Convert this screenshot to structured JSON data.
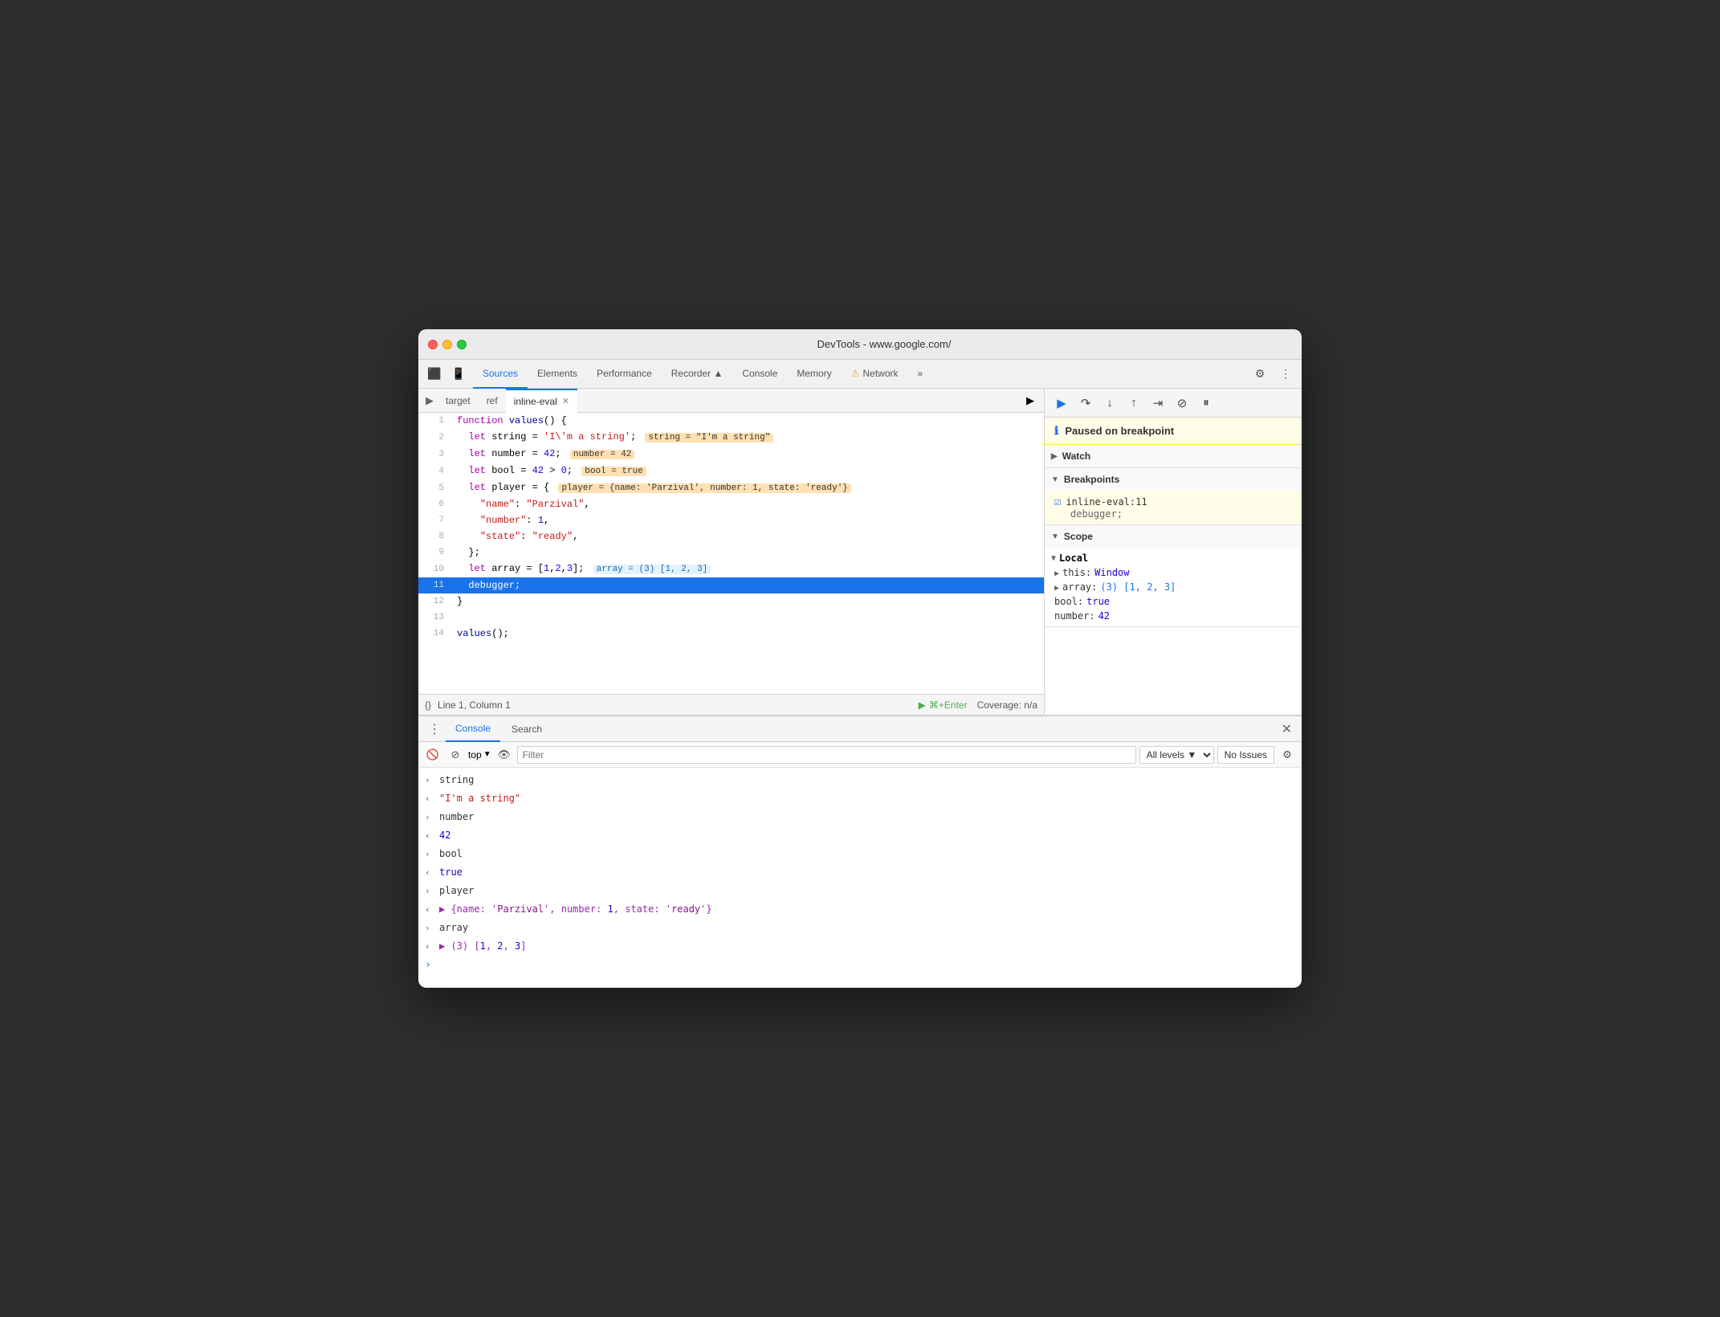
{
  "window": {
    "title": "DevTools - www.google.com/"
  },
  "tabs": {
    "items": [
      {
        "label": "Elements",
        "active": false
      },
      {
        "label": "Sources",
        "active": true
      },
      {
        "label": "Performance",
        "active": false
      },
      {
        "label": "Recorder ▲",
        "active": false
      },
      {
        "label": "Console",
        "active": false
      },
      {
        "label": "Memory",
        "active": false
      },
      {
        "label": "Network",
        "active": false
      }
    ],
    "more": "»"
  },
  "file_tabs": {
    "items": [
      {
        "label": "target",
        "active": false,
        "closable": false
      },
      {
        "label": "ref",
        "active": false,
        "closable": false
      },
      {
        "label": "inline-eval",
        "active": true,
        "closable": true
      }
    ]
  },
  "code": {
    "lines": [
      {
        "num": 1,
        "content": "function values() {"
      },
      {
        "num": 2,
        "content": "  let string = 'I\\'m a string';  string = \"I'm a string\""
      },
      {
        "num": 3,
        "content": "  let number = 42;  number = 42"
      },
      {
        "num": 4,
        "content": "  let bool = 42 > 0;  bool = true"
      },
      {
        "num": 5,
        "content": "  let player = {  player = {name: 'Parzival', number: 1, state: 'ready'}"
      },
      {
        "num": 6,
        "content": "    \"name\": \"Parzival\","
      },
      {
        "num": 7,
        "content": "    \"number\": 1,"
      },
      {
        "num": 8,
        "content": "    \"state\": \"ready\","
      },
      {
        "num": 9,
        "content": "  };"
      },
      {
        "num": 10,
        "content": "  let array = [1,2,3];  array = (3) [1, 2, 3]"
      },
      {
        "num": 11,
        "content": "  debugger;",
        "active_debug": true
      },
      {
        "num": 12,
        "content": "}"
      },
      {
        "num": 13,
        "content": ""
      },
      {
        "num": 14,
        "content": "values();"
      }
    ]
  },
  "status_bar": {
    "braces": "{}",
    "position": "Line 1, Column 1",
    "run_label": "⌘+Enter",
    "coverage": "Coverage: n/a"
  },
  "debug_toolbar": {
    "buttons": [
      "resume",
      "step-over",
      "step-into",
      "step-out",
      "step",
      "deactivate",
      "pause-on-exception"
    ]
  },
  "paused_banner": {
    "text": "Paused on breakpoint"
  },
  "watch": {
    "label": "Watch"
  },
  "breakpoints": {
    "label": "Breakpoints",
    "item_name": "inline-eval:11",
    "item_code": "debugger;"
  },
  "scope": {
    "label": "Scope",
    "local_label": "Local",
    "items": [
      {
        "key": "this:",
        "value": "Window"
      },
      {
        "key": "array:",
        "value": "(3) [1, 2, 3]",
        "color": "blue"
      },
      {
        "key": "bool:",
        "value": "true"
      },
      {
        "key": "number:",
        "value": "42"
      }
    ]
  },
  "console": {
    "tabs": [
      {
        "label": "Console",
        "active": true
      },
      {
        "label": "Search",
        "active": false
      }
    ],
    "toolbar": {
      "top_label": "top",
      "filter_placeholder": "Filter",
      "levels_label": "All levels ▼",
      "no_issues_label": "No Issues"
    },
    "entries": [
      {
        "type": "input",
        "text": "string"
      },
      {
        "type": "output",
        "text": "\"I'm a string\"",
        "style": "str-val"
      },
      {
        "type": "input",
        "text": "number"
      },
      {
        "type": "output",
        "text": "42",
        "style": "num-val"
      },
      {
        "type": "input",
        "text": "bool"
      },
      {
        "type": "output",
        "text": "true",
        "style": "bool-val"
      },
      {
        "type": "input",
        "text": "player"
      },
      {
        "type": "output",
        "text": "▶ {name: 'Parzival', number: 1, state: 'ready'}",
        "style": "purple"
      },
      {
        "type": "input",
        "text": "array"
      },
      {
        "type": "output",
        "text": "◀ (3) [1, 2, 3]",
        "style": "purple"
      }
    ],
    "prompt": ">"
  }
}
